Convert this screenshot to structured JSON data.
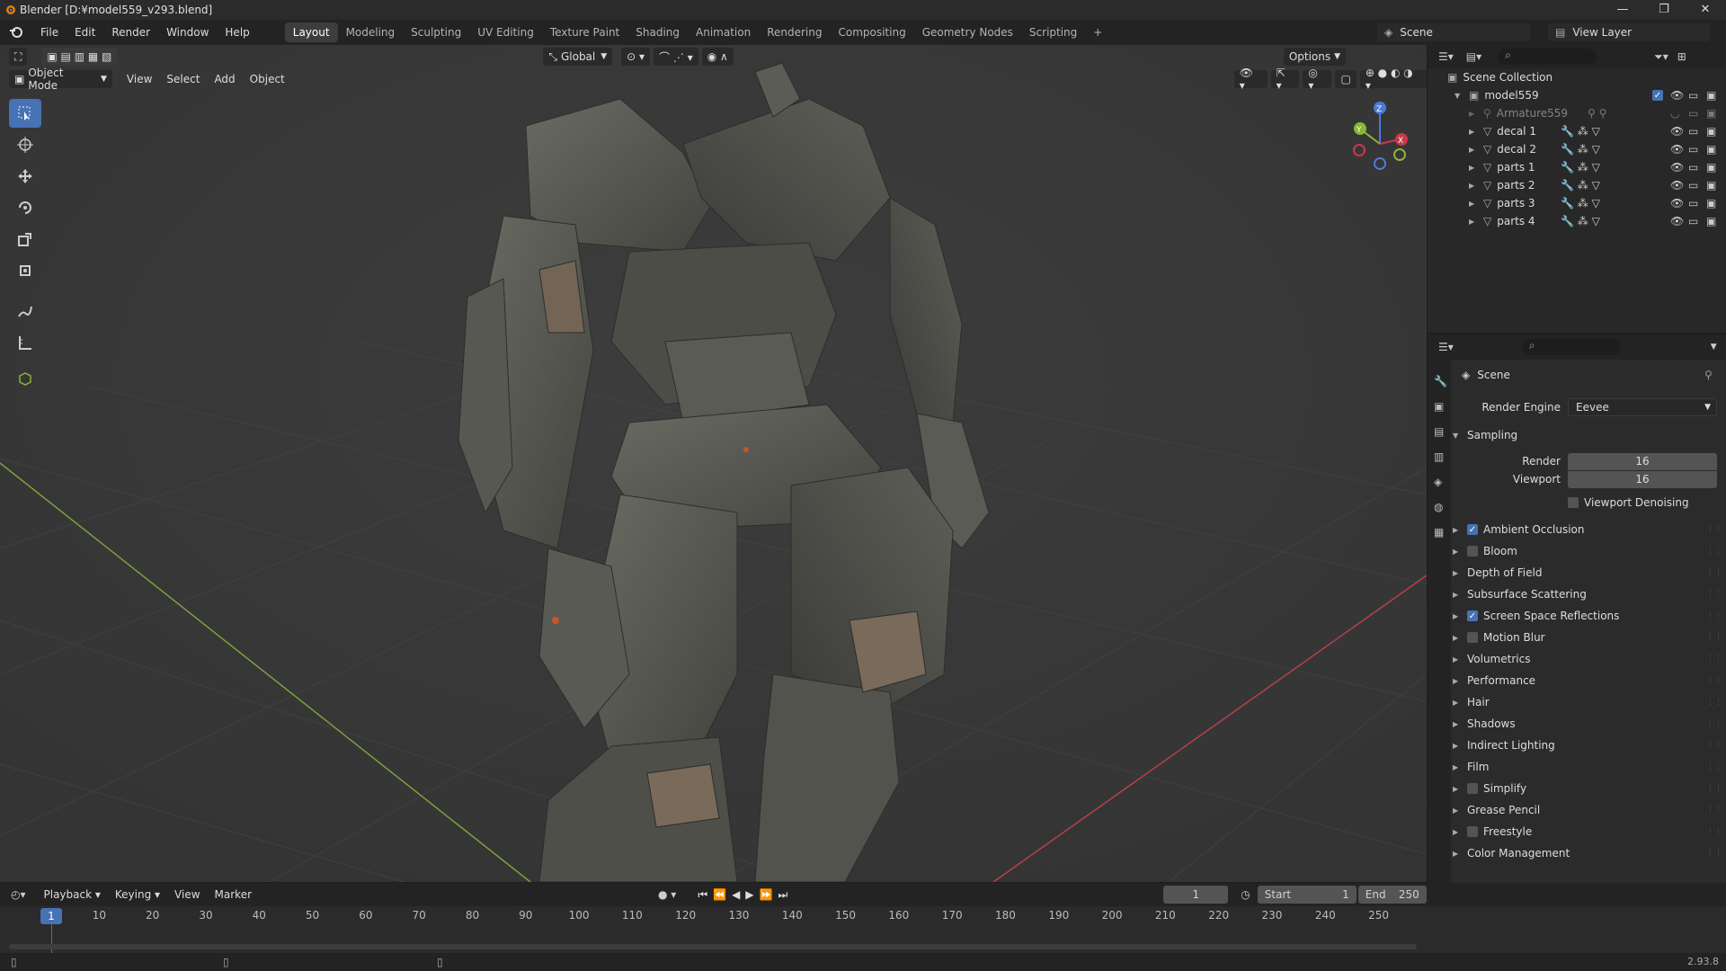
{
  "window": {
    "title": "Blender [D:¥model559_v293.blend]",
    "min": "—",
    "max": "❐",
    "close": "✕"
  },
  "menu": [
    "File",
    "Edit",
    "Render",
    "Window",
    "Help"
  ],
  "workspaces": [
    "Layout",
    "Modeling",
    "Sculpting",
    "UV Editing",
    "Texture Paint",
    "Shading",
    "Animation",
    "Rendering",
    "Compositing",
    "Geometry Nodes",
    "Scripting"
  ],
  "active_workspace": "Layout",
  "add_tab": "+",
  "scene_name": "Scene",
  "view_layer": "View Layer",
  "viewport": {
    "transform": "Global",
    "options": "Options",
    "mode": "Object Mode",
    "menus": [
      "View",
      "Select",
      "Add",
      "Object"
    ],
    "gizmo": {
      "z": "Z",
      "y": "Y",
      "x": "X"
    }
  },
  "outliner": {
    "root": "Scene Collection",
    "collection": "model559",
    "items": [
      "Armature559",
      "decal 1",
      "decal 2",
      "parts 1",
      "parts 2",
      "parts 3",
      "parts 4"
    ]
  },
  "properties": {
    "context": "Scene",
    "render_engine_label": "Render Engine",
    "render_engine": "Eevee",
    "sampling": "Sampling",
    "render_label": "Render",
    "render_value": "16",
    "viewport_label": "Viewport",
    "viewport_value": "16",
    "denoise": "Viewport Denoising",
    "panels": [
      {
        "label": "Ambient Occlusion",
        "check": true,
        "checked": true
      },
      {
        "label": "Bloom",
        "check": true,
        "checked": false
      },
      {
        "label": "Depth of Field",
        "check": false
      },
      {
        "label": "Subsurface Scattering",
        "check": false
      },
      {
        "label": "Screen Space Reflections",
        "check": true,
        "checked": true
      },
      {
        "label": "Motion Blur",
        "check": true,
        "checked": false
      },
      {
        "label": "Volumetrics",
        "check": false
      },
      {
        "label": "Performance",
        "check": false
      },
      {
        "label": "Hair",
        "check": false
      },
      {
        "label": "Shadows",
        "check": false
      },
      {
        "label": "Indirect Lighting",
        "check": false
      },
      {
        "label": "Film",
        "check": false
      },
      {
        "label": "Simplify",
        "check": true,
        "checked": false
      },
      {
        "label": "Grease Pencil",
        "check": false
      },
      {
        "label": "Freestyle",
        "check": true,
        "checked": false
      },
      {
        "label": "Color Management",
        "check": false
      }
    ]
  },
  "timeline": {
    "menus": [
      "Playback",
      "Keying",
      "View",
      "Marker"
    ],
    "current_frame": "1",
    "start_label": "Start",
    "start": "1",
    "end_label": "End",
    "end": "250",
    "ticks": [
      "1",
      "10",
      "20",
      "30",
      "40",
      "50",
      "60",
      "70",
      "80",
      "90",
      "100",
      "110",
      "120",
      "130",
      "140",
      "150",
      "160",
      "170",
      "180",
      "190",
      "200",
      "210",
      "220",
      "230",
      "240",
      "250"
    ]
  },
  "status": {
    "version": "2.93.8"
  },
  "colors": {
    "accent": "#4772b3",
    "x_axis": "#c9394b",
    "y_axis": "#8ab635",
    "z_axis": "#4d79d8"
  }
}
